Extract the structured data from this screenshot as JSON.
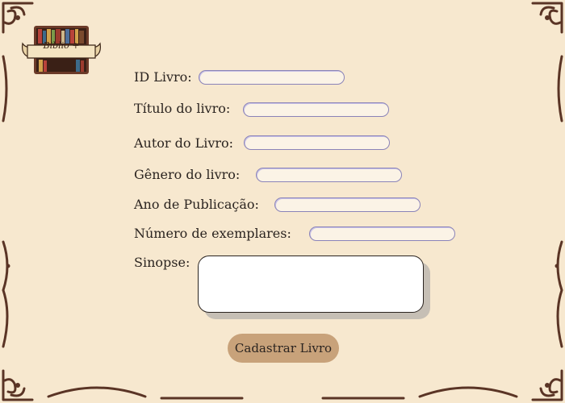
{
  "logo": {
    "text": "Biblio +"
  },
  "form": {
    "fields": [
      {
        "id": "id-livro",
        "label": "ID Livro:",
        "value": ""
      },
      {
        "id": "titulo",
        "label": "Título do livro:",
        "value": ""
      },
      {
        "id": "autor",
        "label": "Autor do Livro:",
        "value": ""
      },
      {
        "id": "genero",
        "label": "Gênero do livro:",
        "value": ""
      },
      {
        "id": "ano",
        "label": "Ano de Publicação:",
        "value": ""
      },
      {
        "id": "exemplares",
        "label": "Número de exemplares:",
        "value": ""
      }
    ],
    "sinopse": {
      "label": "Sinopse:",
      "value": ""
    },
    "submit_label": "Cadastrar Livro"
  },
  "theme": {
    "background": "#f7e8cf",
    "ornament": "#5a3425",
    "button": "#c8a27a",
    "input_border": "#8a83b8"
  }
}
